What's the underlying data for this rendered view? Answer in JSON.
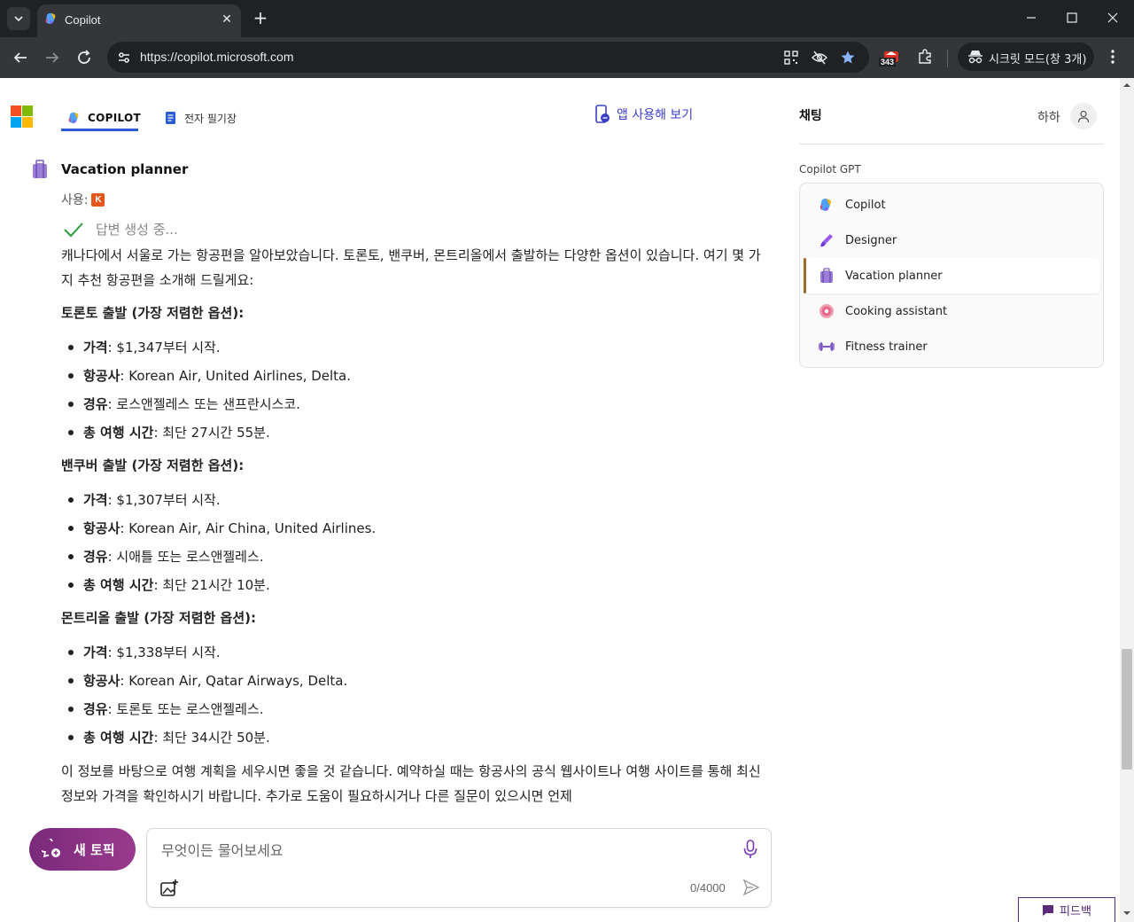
{
  "browser": {
    "tab_title": "Copilot",
    "url": "https://copilot.microsoft.com",
    "extension_badge_count": "343",
    "incognito_label": "시크릿 모드(창 3개)"
  },
  "header": {
    "nav_copilot": "COPILOT",
    "nav_notebook": "전자 필기장",
    "try_app": "앱 사용해 보기"
  },
  "sidebar": {
    "title": "채팅",
    "user_name": "하하",
    "section_label": "Copilot GPT",
    "gpts": [
      {
        "label": "Copilot",
        "icon": "copilot-icon"
      },
      {
        "label": "Designer",
        "icon": "designer-icon"
      },
      {
        "label": "Vacation planner",
        "icon": "suitcase-icon",
        "selected": true
      },
      {
        "label": "Cooking assistant",
        "icon": "donut-icon"
      },
      {
        "label": "Fitness trainer",
        "icon": "dumbbell-icon"
      }
    ]
  },
  "conversation": {
    "bot_name": "Vacation planner",
    "using_label": "사용:",
    "using_badge": "K",
    "status": "답변 생성 중...",
    "intro": "캐나다에서 서울로 가는 항공편을 알아보았습니다. 토론토, 밴쿠버, 몬트리올에서 출발하는 다양한 옵션이 있습니다. 여기 몇 가지 추천 항공편을 소개해 드릴게요:",
    "sections": [
      {
        "heading": "토론토 출발 (가장 저렴한 옵션):",
        "items": [
          {
            "key": "가격",
            "value": ": $1,347부터 시작."
          },
          {
            "key": "항공사",
            "value": ": Korean Air, United Airlines, Delta."
          },
          {
            "key": "경유",
            "value": ": 로스앤젤레스 또는 샌프란시스코."
          },
          {
            "key": "총 여행 시간",
            "value": ": 최단 27시간 55분."
          }
        ]
      },
      {
        "heading": "밴쿠버 출발 (가장 저렴한 옵션):",
        "items": [
          {
            "key": "가격",
            "value": ": $1,307부터 시작."
          },
          {
            "key": "항공사",
            "value": ": Korean Air, Air China, United Airlines."
          },
          {
            "key": "경유",
            "value": ": 시애틀 또는 로스앤젤레스."
          },
          {
            "key": "총 여행 시간",
            "value": ": 최단 21시간 10분."
          }
        ]
      },
      {
        "heading": "몬트리올 출발 (가장 저렴한 옵션):",
        "items": [
          {
            "key": "가격",
            "value": ": $1,338부터 시작."
          },
          {
            "key": "항공사",
            "value": ": Korean Air, Qatar Airways, Delta."
          },
          {
            "key": "경유",
            "value": ": 토론토 또는 로스앤젤레스."
          },
          {
            "key": "총 여행 시간",
            "value": ": 최단 34시간 50분."
          }
        ]
      }
    ],
    "outro": "이 정보를 바탕으로 여행 계획을 세우시면 좋을 것 같습니다. 예약하실 때는 항공사의 공식 웹사이트나 여행 사이트를 통해 최신 정보와 가격을 확인하시기 바랍니다. 추가로 도움이 필요하시거나 다른 질문이 있으시면 언제"
  },
  "composer": {
    "new_topic": "새 토픽",
    "placeholder": "무엇이든 물어보세요",
    "char_count": "0/4000"
  },
  "feedback": "피드백",
  "colors": {
    "accent": "#2b5bd7",
    "new_topic": "#8a327f",
    "selected_marker": "#9a6b2a",
    "try_app": "#3b3fc4"
  }
}
